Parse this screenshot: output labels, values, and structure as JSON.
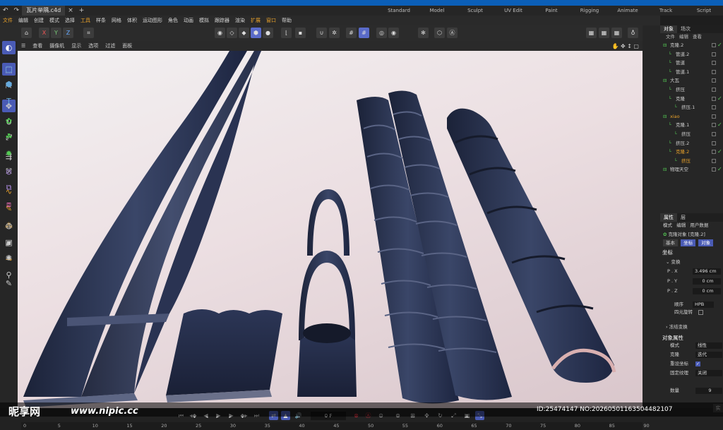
{
  "window": {
    "file_tab": "瓦片举隅.c4d",
    "layouts": [
      "Standard",
      "Model",
      "Sculpt",
      "UV Edit",
      "Paint",
      "Rigging",
      "Animate",
      "Track",
      "Script"
    ]
  },
  "menubar": [
    "文件",
    "编辑",
    "创建",
    "模式",
    "选择",
    "工具",
    "样条",
    "网格",
    "体积",
    "运动图形",
    "角色",
    "动画",
    "模拟",
    "跟踪器",
    "渲染",
    "扩展",
    "窗口",
    "帮助"
  ],
  "toolbar": {
    "axis_x": "X",
    "axis_y": "Y",
    "axis_z": "Z"
  },
  "viewport_menu": [
    "查看",
    "摄像机",
    "显示",
    "选项",
    "过滤",
    "面板"
  ],
  "object_manager": {
    "tabs": [
      "对象",
      "场次"
    ],
    "sub_menu": [
      "文件",
      "编辑",
      "查看"
    ],
    "objects": [
      {
        "name": "克隆.2",
        "indent": 0,
        "color": "#cfcfcf",
        "check": true
      },
      {
        "name": "管道.2",
        "indent": 1,
        "color": "#cfcfcf",
        "check": false
      },
      {
        "name": "管道",
        "indent": 1,
        "color": "#cfcfcf",
        "check": false
      },
      {
        "name": "管道.1",
        "indent": 1,
        "color": "#cfcfcf",
        "check": false
      },
      {
        "name": "大瓦",
        "indent": 0,
        "color": "#cfcfcf",
        "check": false
      },
      {
        "name": "挤压",
        "indent": 1,
        "color": "#cfcfcf",
        "check": false
      },
      {
        "name": "克隆",
        "indent": 1,
        "color": "#cfcfcf",
        "check": true
      },
      {
        "name": "挤压.1",
        "indent": 2,
        "color": "#cfcfcf",
        "check": false
      },
      {
        "name": "xiao",
        "indent": 0,
        "color": "#e8a12a",
        "check": false
      },
      {
        "name": "克隆.1",
        "indent": 1,
        "color": "#cfcfcf",
        "check": true
      },
      {
        "name": "挤压",
        "indent": 2,
        "color": "#cfcfcf",
        "check": false
      },
      {
        "name": "挤压.2",
        "indent": 1,
        "color": "#cfcfcf",
        "check": false
      },
      {
        "name": "克隆.2",
        "indent": 1,
        "color": "#e8a12a",
        "check": true
      },
      {
        "name": "挤压",
        "indent": 2,
        "color": "#e8a12a",
        "check": false
      },
      {
        "name": "物理天空",
        "indent": 0,
        "color": "#cfcfcf",
        "check": true
      }
    ]
  },
  "attributes": {
    "tabs": [
      "属性",
      "层"
    ],
    "sub_menu": [
      "模式",
      "编辑",
      "用户数据"
    ],
    "object_title": "克隆对象 [克隆.2]",
    "mode_tabs": [
      "基本",
      "坐标",
      "对象"
    ],
    "section_coord": "坐标",
    "group_transform": "变换",
    "px_label": "P . X",
    "px_value": "3.496 cm",
    "py_label": "P . Y",
    "py_value": "0 cm",
    "pz_label": "P . Z",
    "pz_value": "0 cm",
    "order_label": "顺序",
    "order_value": "HPB",
    "quat_label": "四元旋转",
    "freeze_label": "冻结变换",
    "section_obj": "对象属性",
    "mode_label": "模式",
    "mode_value": "线性",
    "clone_label": "克隆",
    "clone_value": "迭代",
    "fixclone_label": "重设坐标",
    "fixtex_label": "固定纹理",
    "fixtex_value": "关闭",
    "count_label": "数量",
    "count_value": "9"
  },
  "timeline": {
    "frame_value": "0 F",
    "ticks": [
      "0",
      "5",
      "10",
      "15",
      "20",
      "25",
      "30",
      "35",
      "40",
      "45",
      "50",
      "55",
      "60",
      "65",
      "70",
      "75",
      "80",
      "85",
      "90"
    ],
    "right_label": "实"
  },
  "watermark": {
    "logo": "昵享网",
    "url": "www.nipic.cc",
    "id": "ID:25474147 NO:20260501163504482107"
  },
  "colors": {
    "accent": "#4a5bb5",
    "highlight": "#e8a12a",
    "tile": "#2b3550",
    "check": "#5ac85a"
  }
}
